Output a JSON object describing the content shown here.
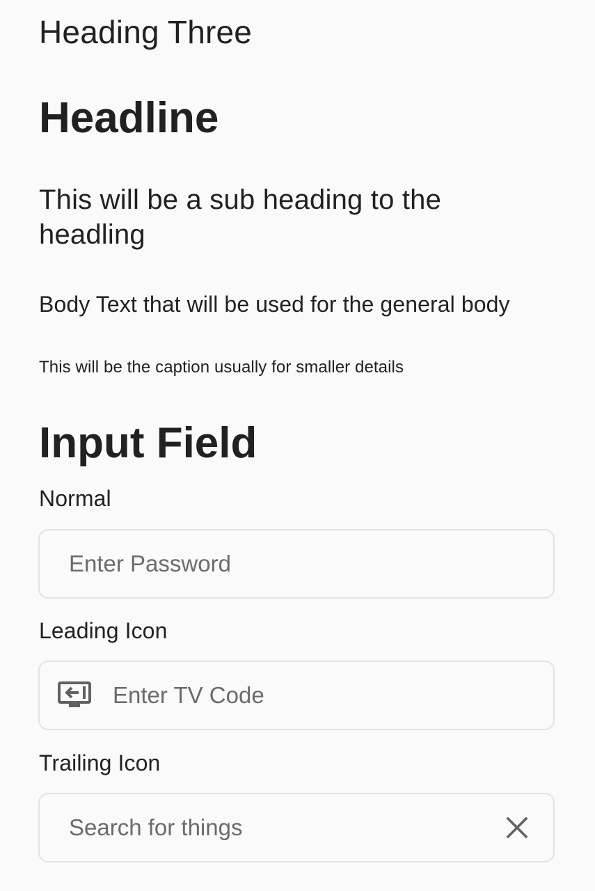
{
  "typography": {
    "heading_three": "Heading Three",
    "headline": "Headline",
    "subheading": "This will be a sub heading to the headling",
    "body": "Body Text that will be used for the general body",
    "caption": "This will be the caption usually for smaller details"
  },
  "input_section": {
    "title": "Input Field",
    "normal": {
      "label": "Normal",
      "placeholder": "Enter Password",
      "value": ""
    },
    "leading_icon": {
      "label": "Leading Icon",
      "placeholder": "Enter TV Code",
      "value": "",
      "icon": "tv-input-icon"
    },
    "trailing_icon": {
      "label": "Trailing Icon",
      "placeholder": "Search for things",
      "value": "",
      "icon": "close-icon"
    }
  },
  "colors": {
    "background": "#fafafa",
    "text": "#212121",
    "placeholder": "#6b6b6b",
    "border": "#e3e3e3",
    "icon": "#616161"
  }
}
